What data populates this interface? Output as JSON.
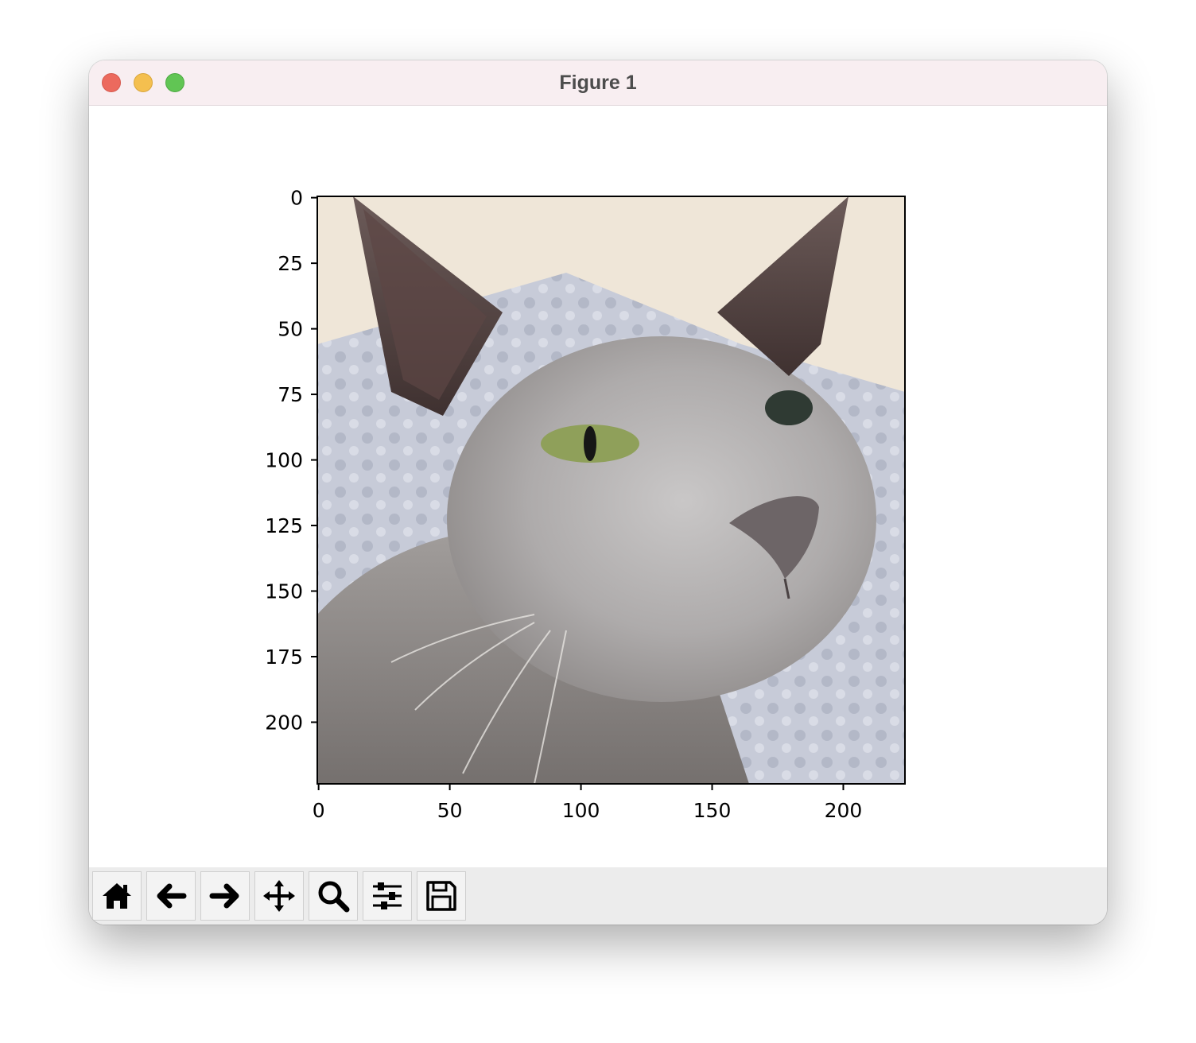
{
  "window": {
    "title": "Figure 1"
  },
  "toolbar": {
    "buttons": [
      {
        "name": "home",
        "icon": "home-icon"
      },
      {
        "name": "back",
        "icon": "arrow-left-icon"
      },
      {
        "name": "forward",
        "icon": "arrow-right-icon"
      },
      {
        "name": "pan",
        "icon": "move-icon"
      },
      {
        "name": "zoom",
        "icon": "magnifier-icon"
      },
      {
        "name": "configure-subplots",
        "icon": "sliders-icon"
      },
      {
        "name": "save",
        "icon": "floppy-disk-icon"
      }
    ]
  },
  "chart_data": {
    "type": "image",
    "image_content": "photo of a grey cat",
    "xlim": [
      -0.5,
      223.5
    ],
    "ylim": [
      223.5,
      -0.5
    ],
    "x_ticks": [
      0,
      50,
      100,
      150,
      200
    ],
    "y_ticks": [
      0,
      25,
      50,
      75,
      100,
      125,
      150,
      175,
      200
    ],
    "x_tick_labels": [
      "0",
      "50",
      "100",
      "150",
      "200"
    ],
    "y_tick_labels": [
      "0",
      "25",
      "50",
      "75",
      "100",
      "125",
      "150",
      "175",
      "200"
    ]
  }
}
